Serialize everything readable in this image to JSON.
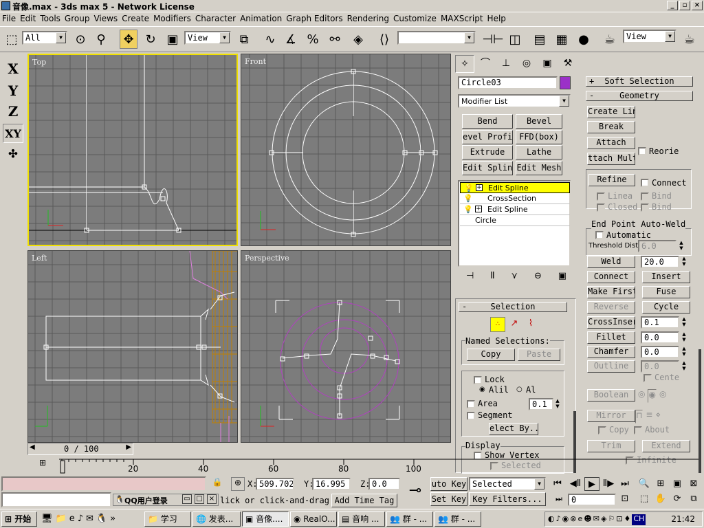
{
  "window": {
    "title": "音像.max - 3ds max 5 - Network License"
  },
  "menu": [
    "File",
    "Edit",
    "Tools",
    "Group",
    "Views",
    "Create",
    "Modifiers",
    "Character",
    "Animation",
    "Graph Editors",
    "Rendering",
    "Customize",
    "MAXScript",
    "Help"
  ],
  "toolbar": {
    "selection_filter": "All",
    "ref_coord": "View",
    "named_sel": "",
    "right_view": "View"
  },
  "axes": [
    "X",
    "Y",
    "Z",
    "XY"
  ],
  "viewports": {
    "top": "Top",
    "front": "Front",
    "left": "Left",
    "perspective": "Perspective"
  },
  "command_panel": {
    "object_name": "Circle03",
    "object_color": "#9b30c8",
    "modifier_list": "Modifier List",
    "modifier_buttons": [
      "Bend",
      "Bevel",
      "evel Profil",
      "FFD(box)",
      "Extrude",
      "Lathe",
      "Edit Spline",
      "Edit Mesh"
    ],
    "stack": [
      {
        "label": "Edit Spline",
        "selected": true,
        "bulb": true,
        "plus": true
      },
      {
        "label": "CrossSection",
        "selected": false,
        "bulb": true,
        "plus": false
      },
      {
        "label": "Edit Spline",
        "selected": false,
        "bulb": true,
        "plus": true
      },
      {
        "label": "Circle",
        "selected": false,
        "bulb": false,
        "plus": false
      }
    ],
    "selection": {
      "header": "Selection",
      "named_label": "Named Selections:",
      "copy": "Copy",
      "paste": "Paste",
      "lock": "Lock",
      "radio1": "Alil",
      "radio2": "Al",
      "area": "Area",
      "area_value": "0.1",
      "segment": "Segment",
      "select_by": "elect By...",
      "display": "Display",
      "show_vertex": "Show Vertex",
      "selected_label": "Selected"
    },
    "soft_selection": "Soft Selection",
    "geometry": {
      "header": "Geometry",
      "create_line": "Create Line",
      "break": "Break",
      "attach": "Attach",
      "reorient": "Reorie",
      "attach_mult": "ttach Mult",
      "refine": "Refine",
      "connect_cb": "Connect",
      "linear": "Linea",
      "bind1": "Bind",
      "closed": "Closed",
      "bind2": "Bind",
      "endpoint": "End Point Auto-Weld",
      "automatic": "Automatic",
      "threshold": "Threshold Dist",
      "threshold_val": "6.0",
      "weld": "Weld",
      "weld_val": "20.0",
      "connect": "Connect",
      "insert": "Insert",
      "make_first": "Make First",
      "fuse": "Fuse",
      "reverse": "Reverse",
      "cycle": "Cycle",
      "crossinsert": "CrossInsert",
      "crossinsert_val": "0.1",
      "fillet": "Fillet",
      "fillet_val": "0.0",
      "chamfer": "Chamfer",
      "chamfer_val": "0.0",
      "outline": "Outline",
      "outline_val": "0.0",
      "center": "Cente",
      "boolean": "Boolean",
      "mirror": "Mirror",
      "copy": "Copy",
      "about": "About",
      "trim": "Trim",
      "extend": "Extend",
      "infinite": "Infinite"
    }
  },
  "timeline": {
    "frame": "0 / 100",
    "ticks": [
      "0",
      "20",
      "40",
      "60",
      "80",
      "100"
    ]
  },
  "status": {
    "x_label": "X:",
    "x": "509.702",
    "y_label": "Y:",
    "y": "16.995",
    "z_label": "Z:",
    "z": "0.0",
    "prompt": "lick or click-and-drag",
    "add_time_tag": "Add Time Tag",
    "auto_key": "uto Key",
    "set_key": "Set Key",
    "selected_dd": "Selected",
    "key_filters": "Key Filters...",
    "frame_field": "0",
    "qq_title": "QQ用户登录"
  },
  "taskbar": {
    "start": "开始",
    "tasks": [
      "学习",
      "发表...",
      "音像....",
      "RealO...",
      "音响 ...",
      "群 - ...",
      "群 - ..."
    ],
    "clock": "21:42"
  }
}
